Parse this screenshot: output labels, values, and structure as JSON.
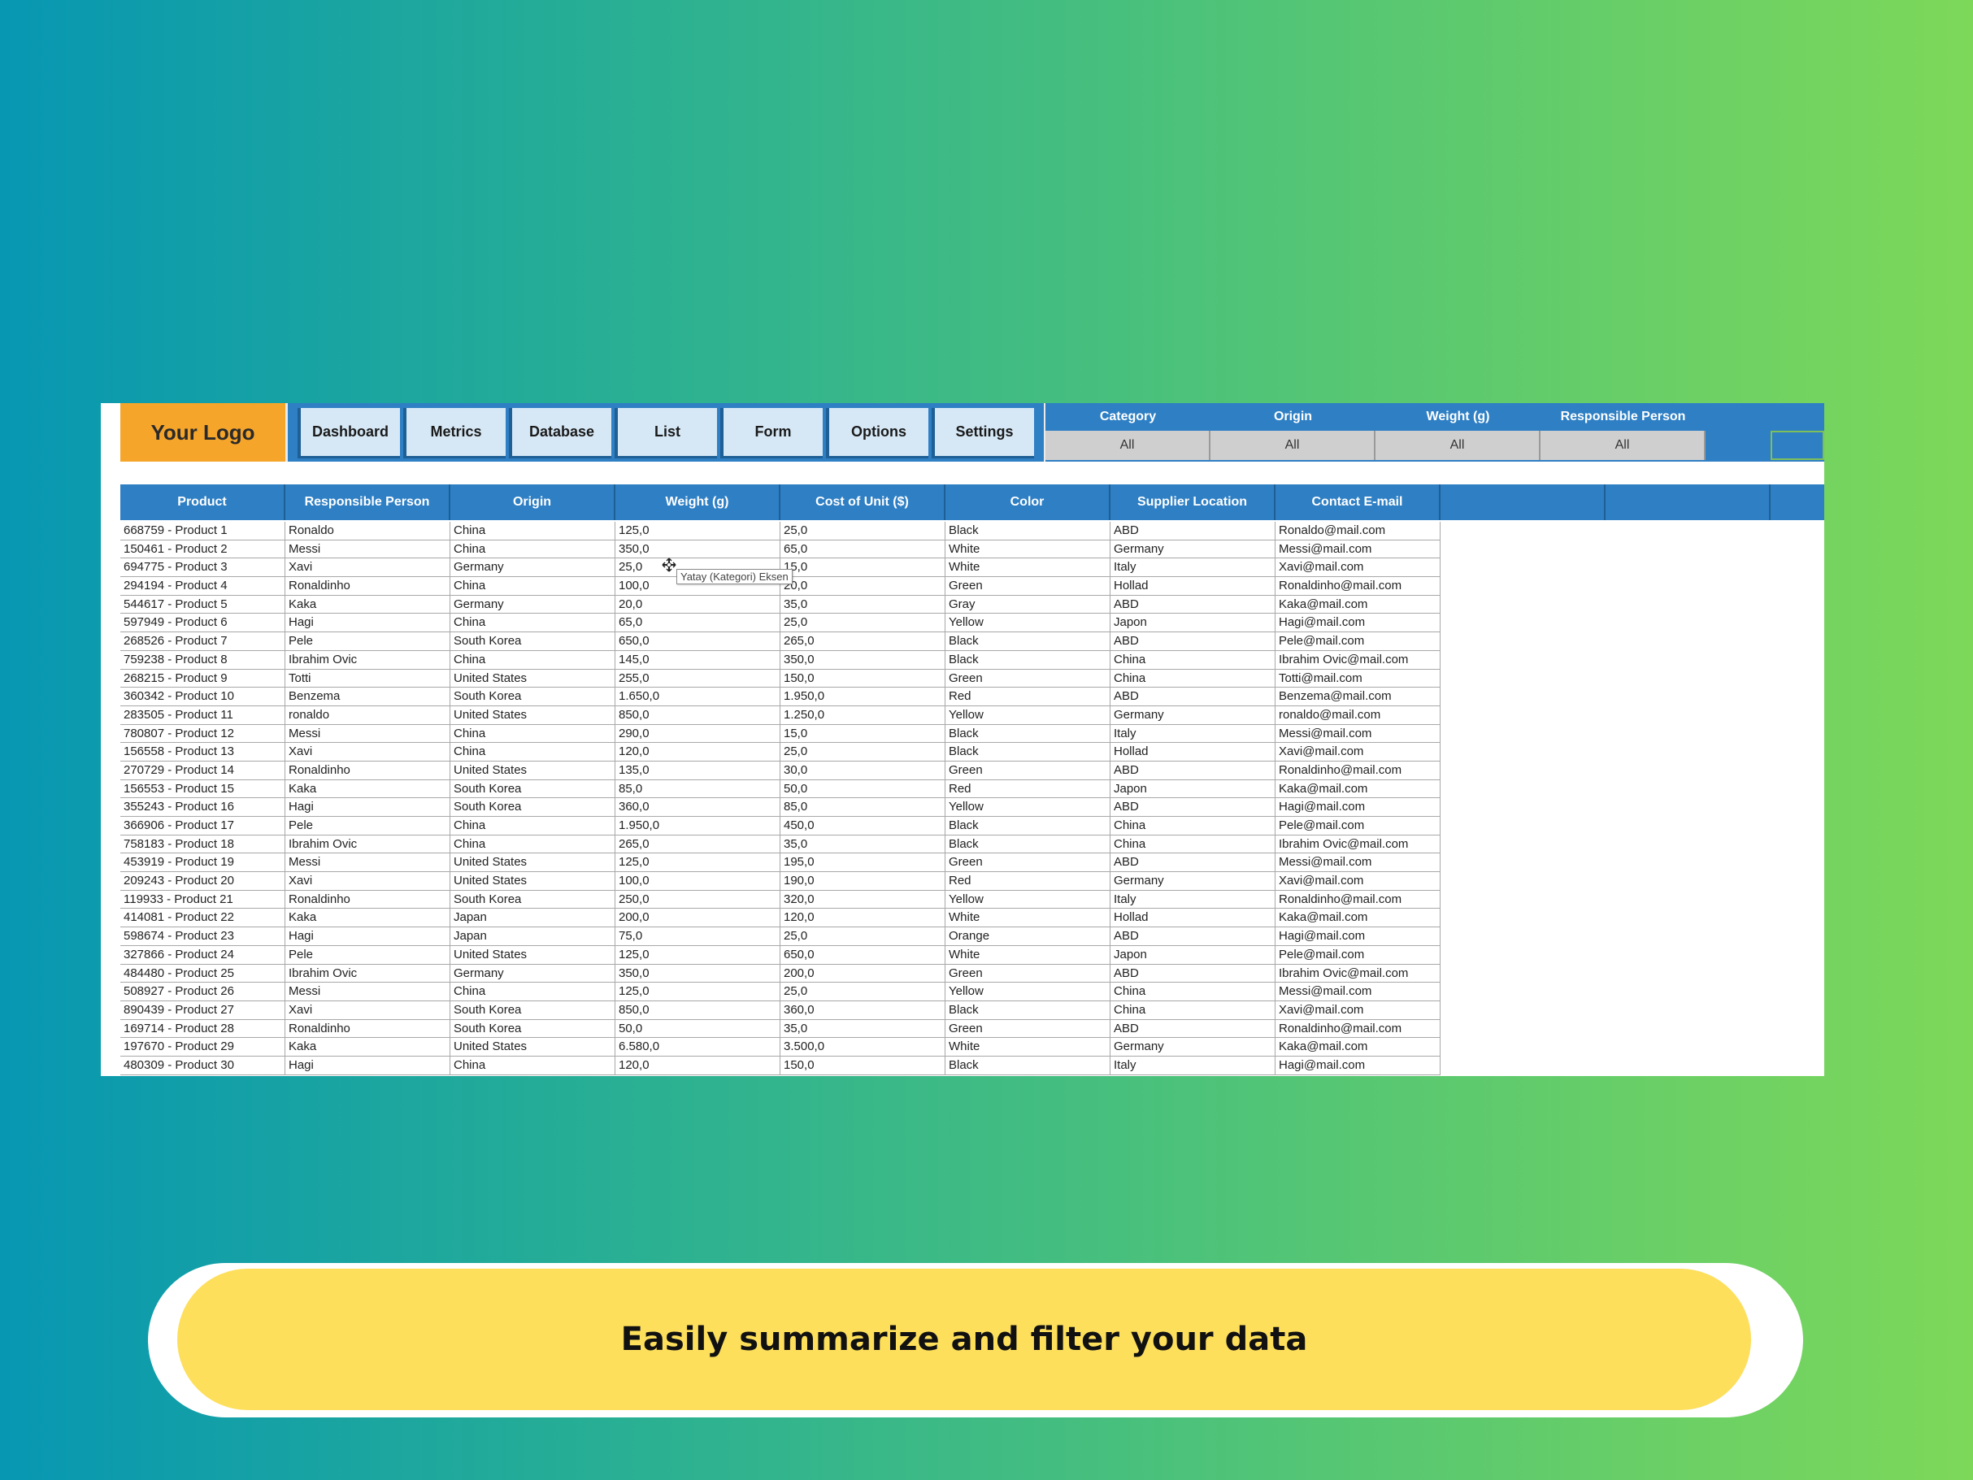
{
  "logo": "Your Logo",
  "nav": [
    "Dashboard",
    "Metrics",
    "Database",
    "List",
    "Form",
    "Options",
    "Settings"
  ],
  "filters": [
    {
      "label": "Category",
      "value": "All"
    },
    {
      "label": "Origin",
      "value": "All"
    },
    {
      "label": "Weight (g)",
      "value": "All"
    },
    {
      "label": "Responsible Person",
      "value": "All"
    }
  ],
  "table": {
    "headers": [
      "Product",
      "Responsible Person",
      "Origin",
      "Weight (g)",
      "Cost of Unit ($)",
      "Color",
      "Supplier Location",
      "Contact E-mail"
    ],
    "rows": [
      [
        "668759 - Product 1",
        "Ronaldo",
        "China",
        "125,0",
        "25,0",
        "Black",
        "ABD",
        "Ronaldo@mail.com"
      ],
      [
        "150461 - Product 2",
        "Messi",
        "China",
        "350,0",
        "65,0",
        "White",
        "Germany",
        "Messi@mail.com"
      ],
      [
        "694775 - Product 3",
        "Xavi",
        "Germany",
        "25,0",
        "15,0",
        "White",
        "Italy",
        "Xavi@mail.com"
      ],
      [
        "294194 - Product 4",
        "Ronaldinho",
        "China",
        "100,0",
        "20,0",
        "Green",
        "Hollad",
        "Ronaldinho@mail.com"
      ],
      [
        "544617 - Product 5",
        "Kaka",
        "Germany",
        "20,0",
        "35,0",
        "Gray",
        "ABD",
        "Kaka@mail.com"
      ],
      [
        "597949 - Product 6",
        "Hagi",
        "China",
        "65,0",
        "25,0",
        "Yellow",
        "Japon",
        "Hagi@mail.com"
      ],
      [
        "268526 - Product 7",
        "Pele",
        "South Korea",
        "650,0",
        "265,0",
        "Black",
        "ABD",
        "Pele@mail.com"
      ],
      [
        "759238 - Product 8",
        "Ibrahim Ovic",
        "China",
        "145,0",
        "350,0",
        "Black",
        "China",
        "Ibrahim Ovic@mail.com"
      ],
      [
        "268215 - Product 9",
        "Totti",
        "United States",
        "255,0",
        "150,0",
        "Green",
        "China",
        "Totti@mail.com"
      ],
      [
        "360342 - Product 10",
        "Benzema",
        "South Korea",
        "1.650,0",
        "1.950,0",
        "Red",
        "ABD",
        "Benzema@mail.com"
      ],
      [
        "283505 - Product 11",
        "ronaldo",
        "United States",
        "850,0",
        "1.250,0",
        "Yellow",
        "Germany",
        "ronaldo@mail.com"
      ],
      [
        "780807 - Product 12",
        "Messi",
        "China",
        "290,0",
        "15,0",
        "Black",
        "Italy",
        "Messi@mail.com"
      ],
      [
        "156558 - Product 13",
        "Xavi",
        "China",
        "120,0",
        "25,0",
        "Black",
        "Hollad",
        "Xavi@mail.com"
      ],
      [
        "270729 - Product 14",
        "Ronaldinho",
        "United States",
        "135,0",
        "30,0",
        "Green",
        "ABD",
        "Ronaldinho@mail.com"
      ],
      [
        "156553 - Product 15",
        "Kaka",
        "South Korea",
        "85,0",
        "50,0",
        "Red",
        "Japon",
        "Kaka@mail.com"
      ],
      [
        "355243 - Product 16",
        "Hagi",
        "South Korea",
        "360,0",
        "85,0",
        "Yellow",
        "ABD",
        "Hagi@mail.com"
      ],
      [
        "366906 - Product 17",
        "Pele",
        "China",
        "1.950,0",
        "450,0",
        "Black",
        "China",
        "Pele@mail.com"
      ],
      [
        "758183 - Product 18",
        "Ibrahim Ovic",
        "China",
        "265,0",
        "35,0",
        "Black",
        "China",
        "Ibrahim Ovic@mail.com"
      ],
      [
        "453919 - Product 19",
        "Messi",
        "United States",
        "125,0",
        "195,0",
        "Green",
        "ABD",
        "Messi@mail.com"
      ],
      [
        "209243 - Product 20",
        "Xavi",
        "United States",
        "100,0",
        "190,0",
        "Red",
        "Germany",
        "Xavi@mail.com"
      ],
      [
        "119933 - Product 21",
        "Ronaldinho",
        "South Korea",
        "250,0",
        "320,0",
        "Yellow",
        "Italy",
        "Ronaldinho@mail.com"
      ],
      [
        "414081 - Product 22",
        "Kaka",
        "Japan",
        "200,0",
        "120,0",
        "White",
        "Hollad",
        "Kaka@mail.com"
      ],
      [
        "598674 - Product 23",
        "Hagi",
        "Japan",
        "75,0",
        "25,0",
        "Orange",
        "ABD",
        "Hagi@mail.com"
      ],
      [
        "327866 - Product 24",
        "Pele",
        "United States",
        "125,0",
        "650,0",
        "White",
        "Japon",
        "Pele@mail.com"
      ],
      [
        "484480 - Product 25",
        "Ibrahim Ovic",
        "Germany",
        "350,0",
        "200,0",
        "Green",
        "ABD",
        "Ibrahim Ovic@mail.com"
      ],
      [
        "508927 - Product 26",
        "Messi",
        "China",
        "125,0",
        "25,0",
        "Yellow",
        "China",
        "Messi@mail.com"
      ],
      [
        "890439 - Product 27",
        "Xavi",
        "South Korea",
        "850,0",
        "360,0",
        "Black",
        "China",
        "Xavi@mail.com"
      ],
      [
        "169714 - Product 28",
        "Ronaldinho",
        "South Korea",
        "50,0",
        "35,0",
        "Green",
        "ABD",
        "Ronaldinho@mail.com"
      ],
      [
        "197670 - Product 29",
        "Kaka",
        "United States",
        "6.580,0",
        "3.500,0",
        "White",
        "Germany",
        "Kaka@mail.com"
      ],
      [
        "480309 - Product 30",
        "Hagi",
        "China",
        "120,0",
        "150,0",
        "Black",
        "Italy",
        "Hagi@mail.com"
      ]
    ]
  },
  "tooltip": "Yatay (Kategori) Eksen",
  "banner": "Easily summarize and filter your data",
  "colors": {
    "header_blue": "#2e7fc4",
    "logo_orange": "#f5a52a",
    "tab_light": "#d6e8f6",
    "banner_yellow": "#fddf5c"
  }
}
